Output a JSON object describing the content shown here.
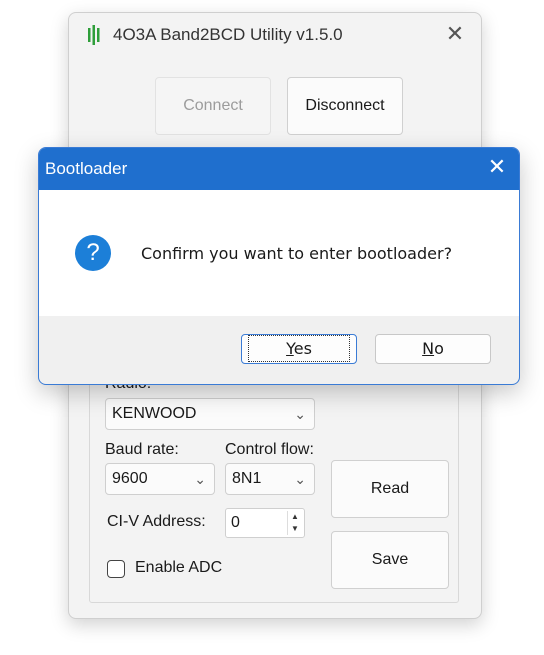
{
  "app": {
    "title": "4O3A Band2BCD Utility v1.5.0",
    "icon": "app-logo-icon",
    "close_glyph": "✕"
  },
  "toolbar": {
    "connect_label": "Connect",
    "connect_enabled": false,
    "disconnect_label": "Disconnect"
  },
  "settings": {
    "radio_label": "Radio:",
    "radio_value": "KENWOOD",
    "baud_label": "Baud rate:",
    "baud_value": "9600",
    "flow_label": "Control flow:",
    "flow_value": "8N1",
    "civ_label": "CI-V Address:",
    "civ_value": "0",
    "adc_label": "Enable ADC",
    "adc_checked": false,
    "read_label": "Read",
    "save_label": "Save"
  },
  "dialog": {
    "title": "Bootloader",
    "close_glyph": "✕",
    "message": "Confirm you want to enter bootloader?",
    "icon": "question-icon",
    "icon_glyph": "?",
    "yes_label_mnemonic": "Y",
    "yes_label_rest": "es",
    "no_label_mnemonic": "N",
    "no_label_rest": "o"
  },
  "colors": {
    "dialog_titlebar": "#1f6fce",
    "dialog_border": "#3a7bd5",
    "question_icon": "#1c7fd8",
    "app_icon_green": "#2e9e3a"
  }
}
